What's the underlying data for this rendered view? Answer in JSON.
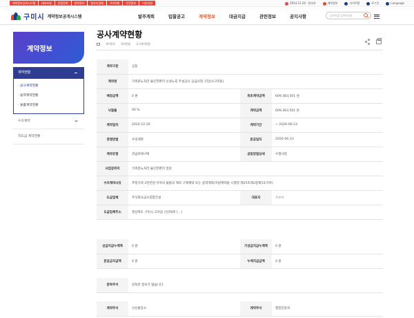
{
  "topbar": {
    "quick_links": [
      {
        "label": "계약정보공개시스템",
        "color": "#e8463a"
      },
      {
        "label": "대표포털",
        "color": "#e8463a"
      },
      {
        "label": "관광문화",
        "color": "#e8463a"
      },
      {
        "label": "분야정보",
        "color": "#e8463a"
      },
      {
        "label": "일자리경제",
        "color": "#e8463a"
      },
      {
        "label": "구미의회",
        "color": "#e8463a"
      },
      {
        "label": "안전정보",
        "color": "#e8463a"
      },
      {
        "label": "기업지원",
        "color": "#e8463a"
      }
    ],
    "util": [
      {
        "label": "2024.12.26 · 접속자",
        "icon": "visitor-icon",
        "color": "#e8463a"
      },
      {
        "label": "계약정보",
        "icon": "contract-icon",
        "color": "#e8463a"
      },
      {
        "label": "사이트맵",
        "icon": "sitemap-icon",
        "color": "#1a3b8a"
      },
      {
        "label": "로그인",
        "icon": "login-icon",
        "color": "#1a3b8a"
      },
      {
        "label": "Language",
        "icon": "globe-icon",
        "color": "#1a3b8a"
      }
    ]
  },
  "header": {
    "city": "구미시",
    "system": "계약정보공개시스템",
    "nav": [
      "발주계획",
      "입찰공고",
      "계약정보",
      "대금지급",
      "관련정보",
      "공지사항"
    ],
    "active_nav": "계약정보",
    "search_placeholder": "검색어를 입력하세요",
    "accent": "#e05a2b"
  },
  "sidebar": {
    "title": "계약정보",
    "group": "계약현황",
    "sub_items": [
      "· 공사계약현황",
      "· 용역계약현황",
      "· 물품계약현황"
    ],
    "items": [
      "수의계약",
      "하도급 계약현황"
    ]
  },
  "main": {
    "title": "공사계약현황",
    "breadcrumb": [
      "계약정보",
      "계약현황",
      "공사계약현황"
    ]
  },
  "table1": [
    {
      "cells": [
        {
          "t": "계약구분",
          "h": true
        },
        {
          "t": "공동",
          "s": 3
        }
      ]
    },
    {
      "cells": [
        {
          "t": "계약명",
          "h": true
        },
        {
          "t": "가축분뇨처리 불신한편지 신설노후 주설공사 공급사업 구입(사구미동)",
          "s": 3
        }
      ]
    },
    {
      "cells": [
        {
          "t": "예정금액",
          "h": true
        },
        {
          "t": "0 원"
        },
        {
          "t": "최초계약금액",
          "h": true
        },
        {
          "t": "609,383,501 원"
        }
      ]
    },
    {
      "cells": [
        {
          "t": "낙찰율",
          "h": true
        },
        {
          "t": "00 %"
        },
        {
          "t": "계약금액",
          "h": true
        },
        {
          "t": "609,383,501 원"
        }
      ]
    },
    {
      "cells": [
        {
          "t": "계약일자",
          "h": true
        },
        {
          "t": "2024-12-26"
        },
        {
          "t": "계약기간",
          "h": true
        },
        {
          "t": "~ 2026-06-23"
        }
      ]
    },
    {
      "cells": [
        {
          "t": "경쟁방법",
          "h": true
        },
        {
          "t": "수의계약"
        },
        {
          "t": "준공일자",
          "h": true
        },
        {
          "t": "2026-06-23"
        }
      ]
    },
    {
      "cells": [
        {
          "t": "계약유형",
          "h": true
        },
        {
          "t": "관급자재구매"
        },
        {
          "t": "공동방법상세",
          "h": true
        },
        {
          "t": "수행사업"
        }
      ]
    },
    {
      "cells": [
        {
          "t": "사업장위치",
          "h": true
        },
        {
          "t": "가축분뇨처리 불신한편지 일원",
          "s": 3
        }
      ]
    },
    {
      "cells": [
        {
          "t": "수의계약사유",
          "h": true
        },
        {
          "t": "추정가격 2천만원 이하의 물품의 제조·구매계약 또는 용역계약(지방계약법 시행령 제25조제1항제5호가목)",
          "s": 3
        }
      ]
    },
    {
      "cells": [
        {
          "t": "도급업체",
          "h": true
        },
        {
          "t": "주식회사금오종합건설"
        },
        {
          "t": "대표자",
          "h": true
        },
        {
          "t": "ㅇㅇㅇ"
        }
      ]
    },
    {
      "cells": [
        {
          "t": "도급업체주소",
          "h": true
        },
        {
          "t": "경상북도 구미시 고아읍 선산대로 [...]",
          "s": 3
        }
      ]
    }
  ],
  "table2": [
    {
      "cells": [
        {
          "t": "선급지급누계액",
          "h": true
        },
        {
          "t": "0 원"
        },
        {
          "t": "기성금지급누계액",
          "h": true
        },
        {
          "t": "0 원"
        }
      ]
    },
    {
      "cells": [
        {
          "t": "준공금지급액",
          "h": true
        },
        {
          "t": "0 원"
        },
        {
          "t": "누계지급금액",
          "h": true
        },
        {
          "t": "0 원"
        }
      ]
    }
  ],
  "table3": [
    {
      "cells": [
        {
          "t": "감독부서",
          "h": true
        },
        {
          "t": "감독관 정보가 없습니다.",
          "s": 3
        }
      ]
    }
  ],
  "table4": [
    {
      "cells": [
        {
          "t": "계약부서",
          "h": true
        },
        {
          "t": "산산출장소"
        },
        {
          "t": "계약부서",
          "h": true
        },
        {
          "t": "행정민원과"
        }
      ]
    }
  ]
}
